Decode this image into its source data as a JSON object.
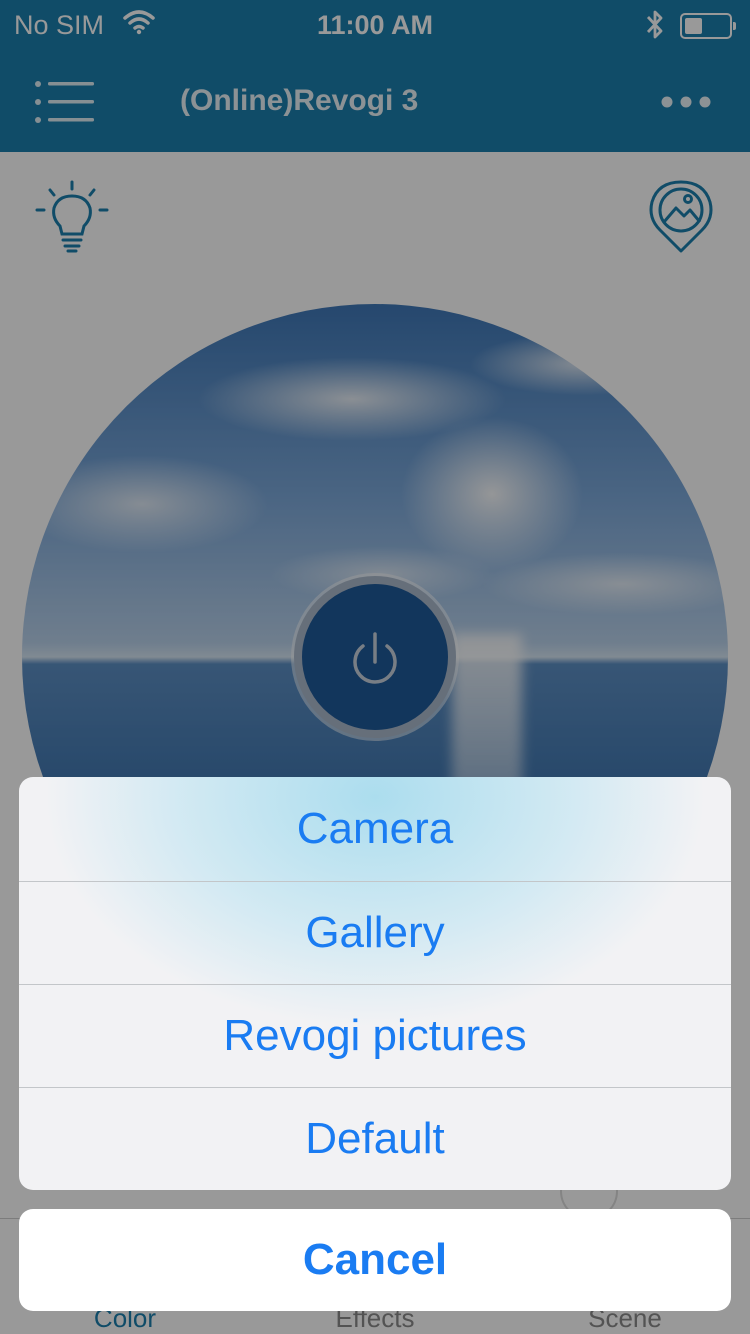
{
  "status_bar": {
    "carrier": "No SIM",
    "time": "11:00 AM",
    "battery_level": 0.4
  },
  "nav": {
    "title": "(Online)Revogi 3",
    "menu_icon": "list-menu-icon",
    "more_icon": "more-dots-icon"
  },
  "toolbar": {
    "light_icon": "light-bulb-icon",
    "scene_icon": "location-picture-icon"
  },
  "power_icon": "power-icon",
  "tabs": [
    {
      "label": "Color",
      "active": true
    },
    {
      "label": "Effects",
      "active": false
    },
    {
      "label": "Scene",
      "active": false
    }
  ],
  "action_sheet": {
    "options": [
      "Camera",
      "Gallery",
      "Revogi pictures",
      "Default"
    ],
    "cancel": "Cancel"
  },
  "colors": {
    "accent": "#1b7fae",
    "action_text": "#1a7cf2"
  }
}
